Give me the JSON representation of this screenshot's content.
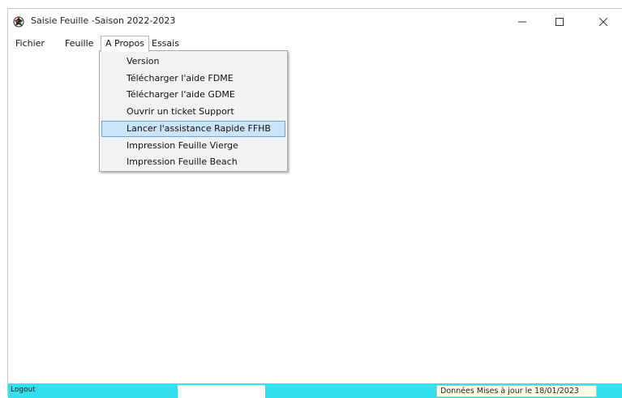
{
  "window": {
    "title": "Saisie Feuille -Saison 2022-2023",
    "icon": "app-icon",
    "controls": {
      "minimize_icon": "minimize-icon",
      "maximize_icon": "maximize-icon",
      "close_icon": "close-icon"
    }
  },
  "menubar": {
    "items": [
      {
        "label": "Fichier"
      },
      {
        "label": "Feuille"
      },
      {
        "label": "A Propos",
        "open": true
      },
      {
        "label": "Essais"
      }
    ]
  },
  "dropdown": {
    "items": [
      {
        "label": "Version"
      },
      {
        "label": "Télécharger l'aide FDME"
      },
      {
        "label": "Télécharger l'aide GDME"
      },
      {
        "label": "Ouvrir un ticket Support"
      },
      {
        "label": "Lancer l'assistance Rapide FFHB",
        "highlighted": true
      },
      {
        "label": "Impression Feuille Vierge"
      },
      {
        "label": "Impression Feuille Beach"
      }
    ]
  },
  "statusbar": {
    "left": "Logout",
    "right": "Données Mises à jour le 18/01/2023"
  },
  "colors": {
    "statusbar_bg": "#33e0ee",
    "highlight_bg": "#cce4f7",
    "highlight_border": "#6aa6d6",
    "menu_bg": "#f2f2f2",
    "status_panel_bg": "#ffffe8"
  }
}
